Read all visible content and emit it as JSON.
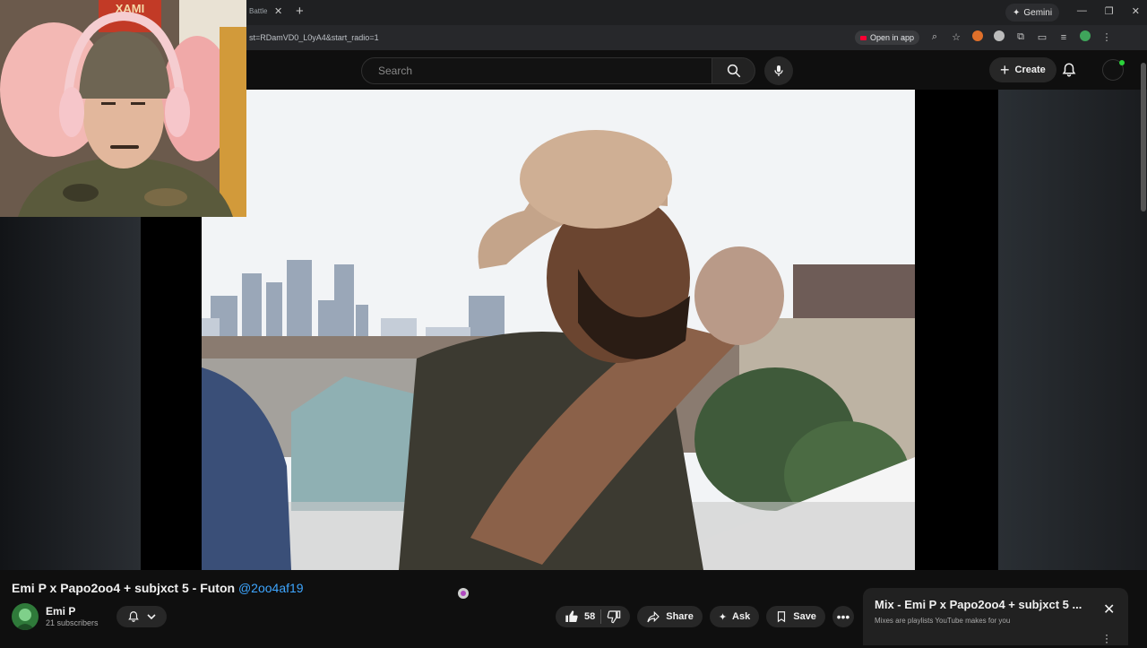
{
  "browser": {
    "tab_title": "Battle",
    "tab_close": "✕",
    "new_tab": "+",
    "gemini_label": "Gemini",
    "url": "st=RDamVD0_L0yA4&start_radio=1",
    "open_in_app": "Open in app"
  },
  "header": {
    "search_placeholder": "Search",
    "create_label": "Create"
  },
  "webcam": {
    "sign_text": "XAMI"
  },
  "video": {
    "title": "Emi P x Papo2oo4 + subjxct 5 - Futon",
    "title_handle": "@2oo4af19"
  },
  "channel": {
    "name": "Emi P",
    "subscribers": "21 subscribers"
  },
  "actions": {
    "like_count": "58",
    "share_label": "Share",
    "ask_label": "Ask",
    "save_label": "Save"
  },
  "mix": {
    "title": "Mix - Emi P x Papo2oo4 + subjxct 5 ...",
    "subtitle": "Mixes are playlists YouTube makes for you"
  },
  "colors": {
    "background": "#0f0f0f",
    "link": "#3ea6ff",
    "accent_red": "#ff0033"
  }
}
